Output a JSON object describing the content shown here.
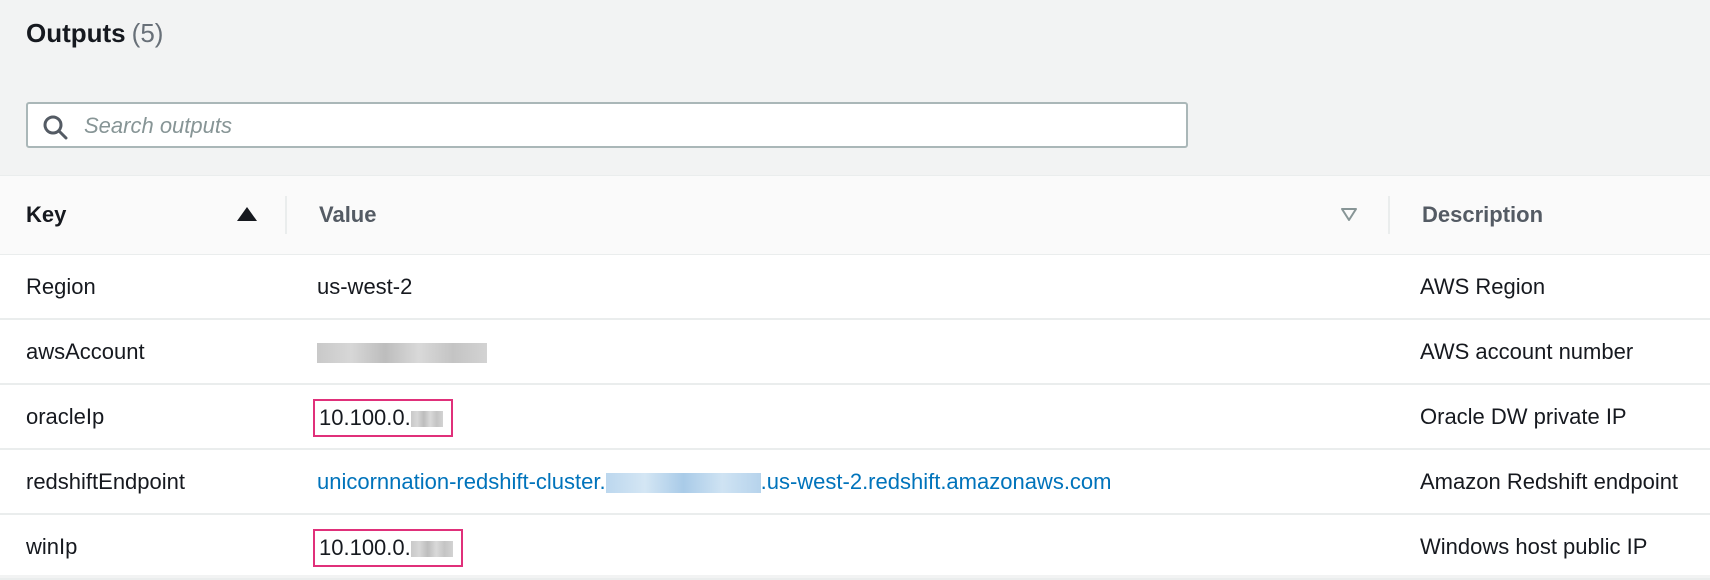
{
  "header": {
    "title": "Outputs",
    "count": "(5)"
  },
  "search": {
    "placeholder": "Search outputs",
    "icon": "search-icon"
  },
  "table": {
    "columns": {
      "key": "Key",
      "value": "Value",
      "description": "Description"
    },
    "sort": {
      "column": "Key",
      "direction": "ascending"
    },
    "rows": [
      {
        "key": "Region",
        "value": "us-west-2",
        "description": "AWS Region"
      },
      {
        "key": "awsAccount",
        "value": "",
        "description": "AWS account number"
      },
      {
        "key": "oracleIp",
        "value": "10.100.0.",
        "description": "Oracle DW private IP"
      },
      {
        "key": "redshiftEndpoint",
        "value_prefix": "unicornnation-redshift-cluster.",
        "value_suffix": ".us-west-2.redshift.amazonaws.com",
        "description": "Amazon Redshift endpoint"
      },
      {
        "key": "winIp",
        "value": "10.100.0.",
        "description": "Windows host public IP"
      }
    ]
  },
  "colors": {
    "link": "#0073bb",
    "highlight_box": "#e0307a",
    "header_bg": "#f2f3f3"
  }
}
